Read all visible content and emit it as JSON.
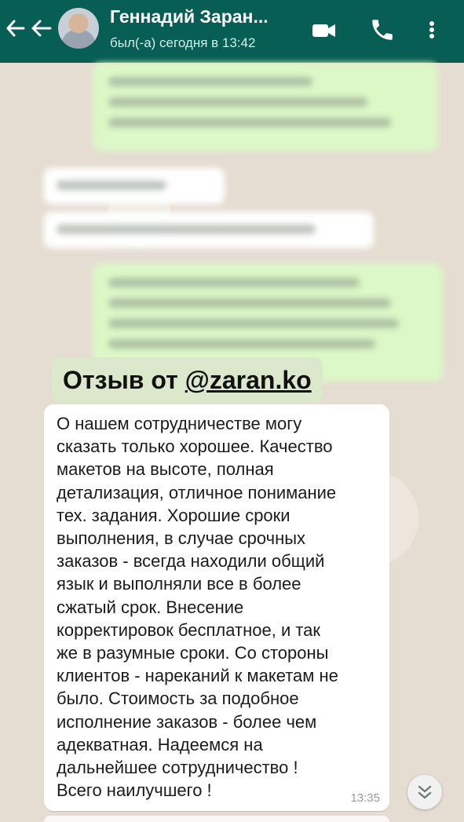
{
  "header": {
    "contact_name": "Геннадий Заран...",
    "status": "был(-а) сегодня в 13:42",
    "background": "#075e54"
  },
  "icons": [
    "back-arrow-icon",
    "video-call-icon",
    "phone-icon",
    "more-options-icon",
    "chevron-down-icon"
  ],
  "banner": {
    "prefix": "Отзыв от ",
    "handle": "@zaran.ko"
  },
  "review": {
    "text": "О нашем сотрудничестве могу\nсказать только хорошее. Качество\nмакетов на высоте, полная\nдетализация, отличное понимание\nтех. задания. Хорошие сроки\nвыполнения, в случае срочных\nзаказов - всегда находили общий\nязык и выполняли все в более\nсжатый срок. Внесение\nкорректировок бесплатное, и так\nже в разумные сроки. Со стороны\nклиентов - нареканий к макетам не\nбыло. Стоимость за подобное\nисполнение заказов - более чем\nадекватная. Надеемся на\nдальнейшее сотрудничество !\nВсего наилучшего !",
    "time": "13:35"
  }
}
